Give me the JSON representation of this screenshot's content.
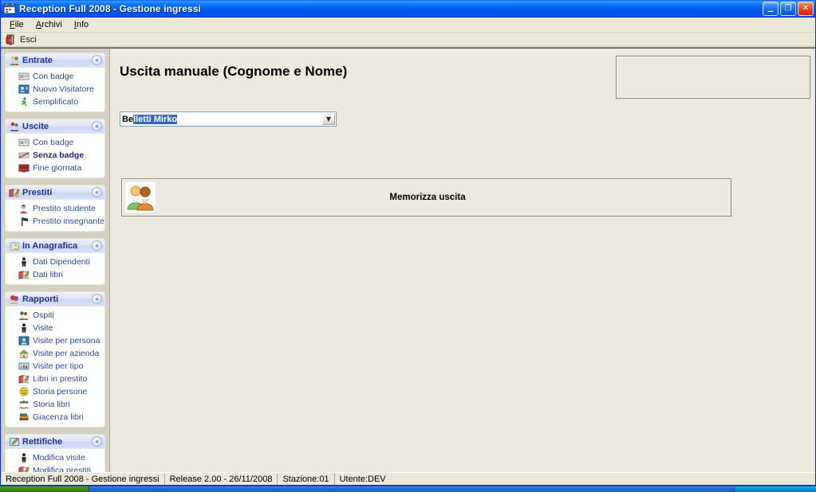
{
  "window": {
    "title": "Reception Full 2008 - Gestione ingressi",
    "title_icon": "calendar-icon",
    "minimize_label": "_",
    "maximize_label": "❐",
    "close_label": "✕"
  },
  "menubar": {
    "items": [
      {
        "label": "File",
        "accel": "F"
      },
      {
        "label": "Archivi",
        "accel": "A"
      },
      {
        "label": "Info",
        "accel": "I"
      }
    ]
  },
  "toolbar": {
    "exit_label": "Esci",
    "exit_icon": "exit-door-icon"
  },
  "sidebar": {
    "collapse_glyph": "«",
    "panels": [
      {
        "title": "Entrate",
        "icon": "people-green-icon",
        "items": [
          {
            "label": "Con badge",
            "icon": "badge-icon",
            "active": false
          },
          {
            "label": "Nuovo Visitatore",
            "icon": "visitor-card-icon",
            "active": false
          },
          {
            "label": "Semplificato",
            "icon": "runner-green-icon",
            "active": false
          }
        ]
      },
      {
        "title": "Uscite",
        "icon": "people-exit-icon",
        "items": [
          {
            "label": "Con badge",
            "icon": "badge-icon",
            "active": false
          },
          {
            "label": "Senza badge",
            "icon": "no-badge-icon",
            "active": true
          },
          {
            "label": "Fine giornata",
            "icon": "red-screen-icon",
            "active": false
          }
        ]
      },
      {
        "title": "Prestiti",
        "icon": "book-pen-icon",
        "items": [
          {
            "label": "Prestito studente",
            "icon": "student-icon",
            "active": false
          },
          {
            "label": "Prestito insegnante",
            "icon": "teacher-flag-icon",
            "active": false
          }
        ]
      },
      {
        "title": "In Anagrafica",
        "icon": "address-book-icon",
        "items": [
          {
            "label": "Dati Dipendenti",
            "icon": "person-black-icon",
            "active": false
          },
          {
            "label": "Dati libri",
            "icon": "book-pen-icon",
            "active": false
          }
        ]
      },
      {
        "title": "Rapporti",
        "icon": "reports-icon",
        "items": [
          {
            "label": "Ospiti",
            "icon": "guests-icon",
            "active": false
          },
          {
            "label": "Visite",
            "icon": "person-black-icon",
            "active": false
          },
          {
            "label": "Visite per persona",
            "icon": "person-photo-icon",
            "active": false
          },
          {
            "label": "Visite per azienda",
            "icon": "house-icon",
            "active": false
          },
          {
            "label": "Visite per tipo",
            "icon": "chart-blue-icon",
            "active": false
          },
          {
            "label": "Libri in prestito",
            "icon": "book-pen-icon",
            "active": false
          },
          {
            "label": "Storia persone",
            "icon": "smiley-icon",
            "active": false
          },
          {
            "label": "Storia libri",
            "icon": "group-icon",
            "active": false
          },
          {
            "label": "Giacenza libri",
            "icon": "books-stack-icon",
            "active": false
          }
        ]
      },
      {
        "title": "Rettifiche",
        "icon": "edit-icon",
        "items": [
          {
            "label": "Modifica visite",
            "icon": "person-black-icon",
            "active": false
          },
          {
            "label": "Modifica prestiti",
            "icon": "book-pen-icon",
            "active": false
          }
        ]
      }
    ]
  },
  "main": {
    "page_title": "Uscita manuale (Cognome e Nome)",
    "info_panel": {
      "name": "empty-info-panel",
      "content": ""
    },
    "combo": {
      "typed_text": "Be",
      "completion_text": "lletti Mirko",
      "full_value": "Belletti Mirko",
      "arrow_glyph": "▼"
    },
    "action_button": {
      "label": "Memorizza uscita",
      "icon": "two-people-icon"
    }
  },
  "statusbar": {
    "cells": [
      "Reception Full 2008 - Gestione ingressi",
      "Release 2.00 - 26/11/2008",
      "Stazione:01",
      "Utente:DEV"
    ]
  },
  "colors": {
    "title_bar_blue": "#0054e3",
    "panel_header_blue": "#21319c",
    "link_blue": "#2b4b9b",
    "selection_blue": "#316ac5",
    "app_beige": "#ece9d8",
    "sidebar_beige": "#d6d2c2",
    "main_beige": "#eceade"
  }
}
